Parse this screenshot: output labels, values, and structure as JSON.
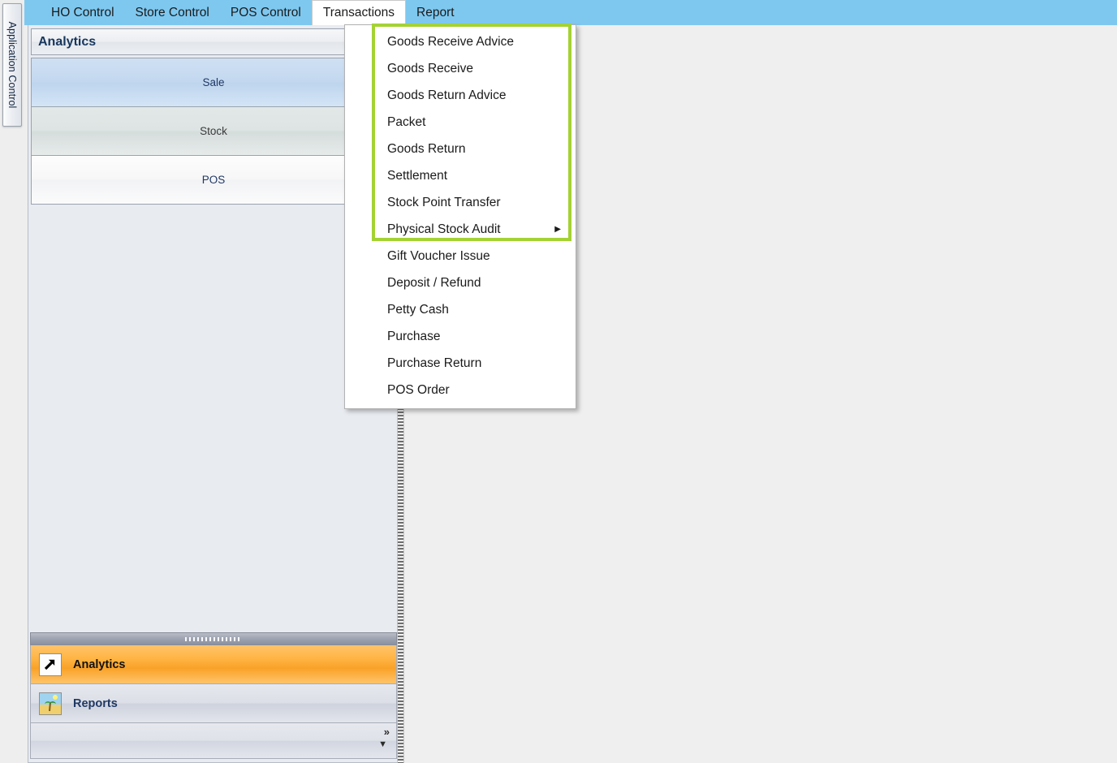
{
  "dock": {
    "tab_label": "Application Control"
  },
  "menubar": {
    "items": [
      {
        "label": "HO Control",
        "active": false
      },
      {
        "label": "Store Control",
        "active": false
      },
      {
        "label": "POS Control",
        "active": false
      },
      {
        "label": "Transactions",
        "active": true
      },
      {
        "label": "Report",
        "active": false
      }
    ],
    "bar_color": "#7ec8f0"
  },
  "nav_panel": {
    "header_title": "Analytics",
    "bands": [
      {
        "label": "Sale",
        "state": "selected"
      },
      {
        "label": "Stock",
        "state": "hover"
      },
      {
        "label": "POS",
        "state": "normal"
      }
    ]
  },
  "bottom_stack": {
    "items": [
      {
        "label": "Analytics",
        "icon": "arrow-up-right-icon",
        "selected": true
      },
      {
        "label": "Reports",
        "icon": "picture-icon",
        "selected": false
      }
    ],
    "overflow_chevrons": "»",
    "overflow_caret": "▼",
    "selected_color": "#f9a228"
  },
  "dropdown": {
    "owner": "Transactions",
    "items": [
      {
        "label": "Goods Receive Advice",
        "submenu": false,
        "highlighted": true
      },
      {
        "label": "Goods Receive",
        "submenu": false,
        "highlighted": true
      },
      {
        "label": "Goods Return Advice",
        "submenu": false,
        "highlighted": true
      },
      {
        "label": "Packet",
        "submenu": false,
        "highlighted": true
      },
      {
        "label": "Goods Return",
        "submenu": false,
        "highlighted": true
      },
      {
        "label": "Settlement",
        "submenu": false,
        "highlighted": true
      },
      {
        "label": "Stock Point Transfer",
        "submenu": false,
        "highlighted": true
      },
      {
        "label": "Physical Stock Audit",
        "submenu": true,
        "highlighted": true
      },
      {
        "label": "Gift Voucher Issue",
        "submenu": false,
        "highlighted": false
      },
      {
        "label": "Deposit / Refund",
        "submenu": false,
        "highlighted": false
      },
      {
        "label": "Petty Cash",
        "submenu": false,
        "highlighted": false
      },
      {
        "label": "Purchase",
        "submenu": false,
        "highlighted": false
      },
      {
        "label": "Purchase Return",
        "submenu": false,
        "highlighted": false
      },
      {
        "label": "POS Order",
        "submenu": false,
        "highlighted": false
      }
    ],
    "submenu_arrow": "▶",
    "highlight_color": "#a4d233"
  }
}
